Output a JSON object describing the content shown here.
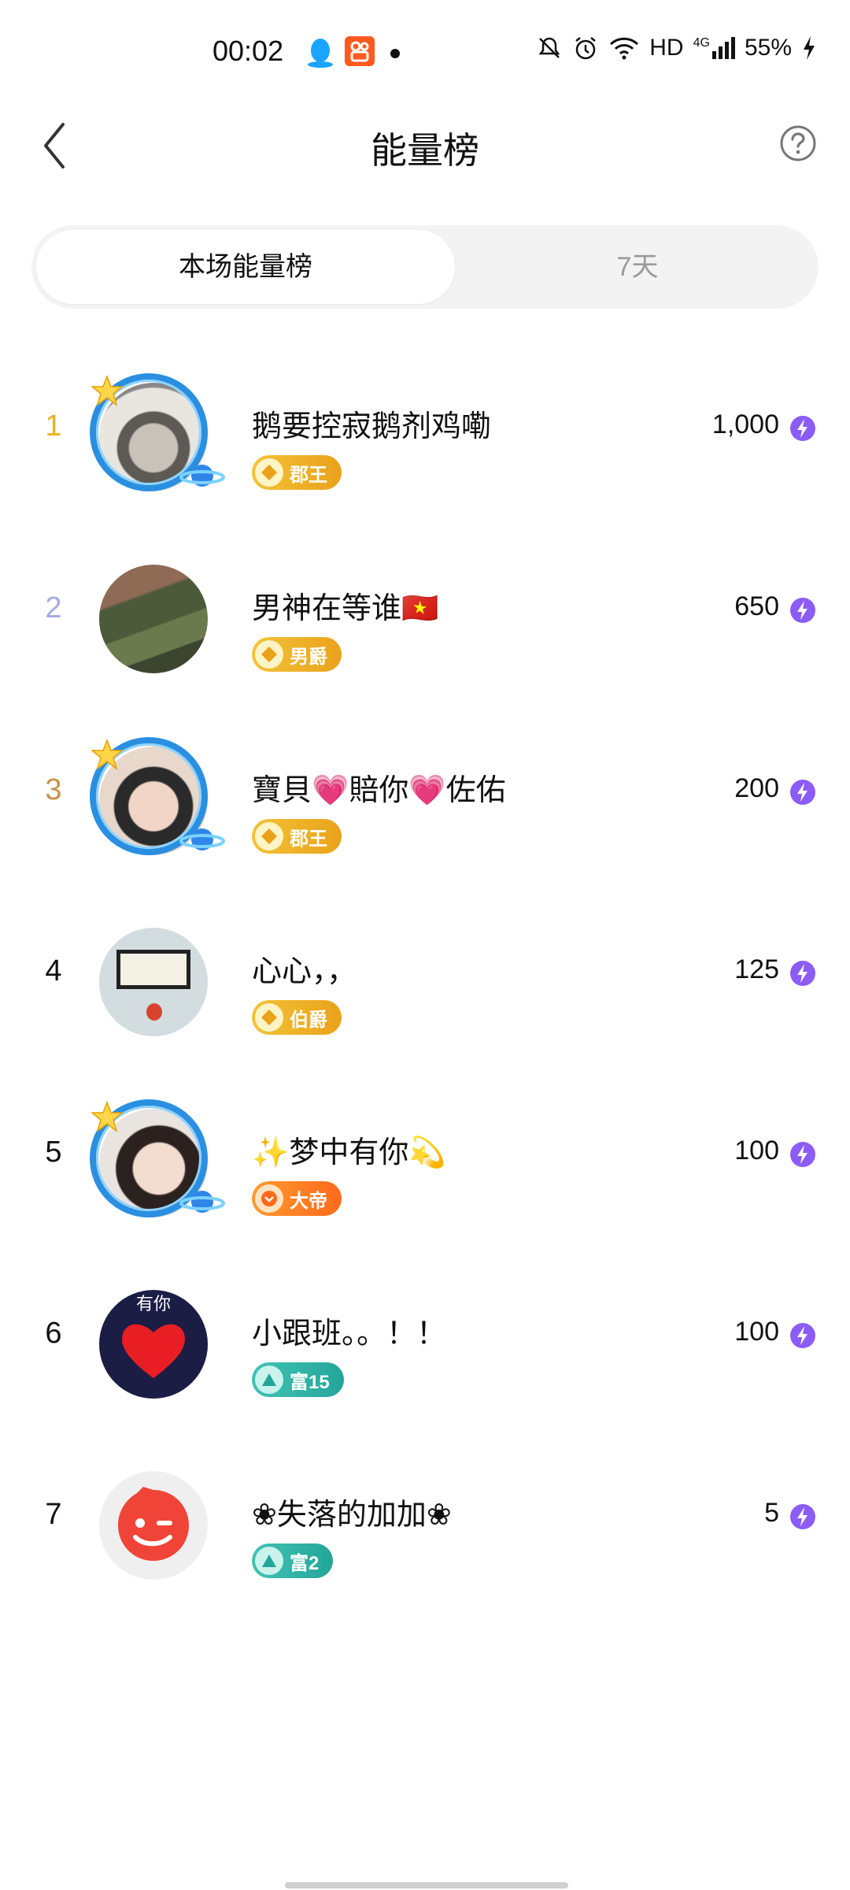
{
  "status_bar": {
    "time": "00:02",
    "network_label": "HD",
    "signal_label": "4G",
    "battery": "55%"
  },
  "header": {
    "title": "能量榜",
    "back_icon": "chevron-left-icon",
    "help_icon": "question-circle-icon"
  },
  "tabs": [
    {
      "label": "本场能量榜",
      "active": true
    },
    {
      "label": "7天",
      "active": false
    }
  ],
  "colors": {
    "rank1": "#e8b321",
    "rank2": "#a9a9e0",
    "rank3": "#c8914a",
    "accent_purple": "#8b5cf6"
  },
  "entries": [
    {
      "rank": "1",
      "name": "鹅要控寂鹅剂鸡嘞",
      "badge": "郡王",
      "score": "1,000"
    },
    {
      "rank": "2",
      "name": "男神在等谁🇻🇳",
      "badge": "男爵",
      "score": "650"
    },
    {
      "rank": "3",
      "name": "寶貝💗賠你💗佐佑",
      "badge": "郡王",
      "score": "200"
    },
    {
      "rank": "4",
      "name": "心心，，",
      "badge": "伯爵",
      "score": "125"
    },
    {
      "rank": "5",
      "name": "✨梦中有你💫",
      "badge": "大帝",
      "score": "100"
    },
    {
      "rank": "6",
      "name": "小跟班。。！！",
      "badge": "富15",
      "score": "100"
    },
    {
      "rank": "7",
      "name": "❀失落的加加❀",
      "badge": "富2",
      "score": "5"
    }
  ],
  "avatar_texts": {
    "entry6": "有你"
  }
}
